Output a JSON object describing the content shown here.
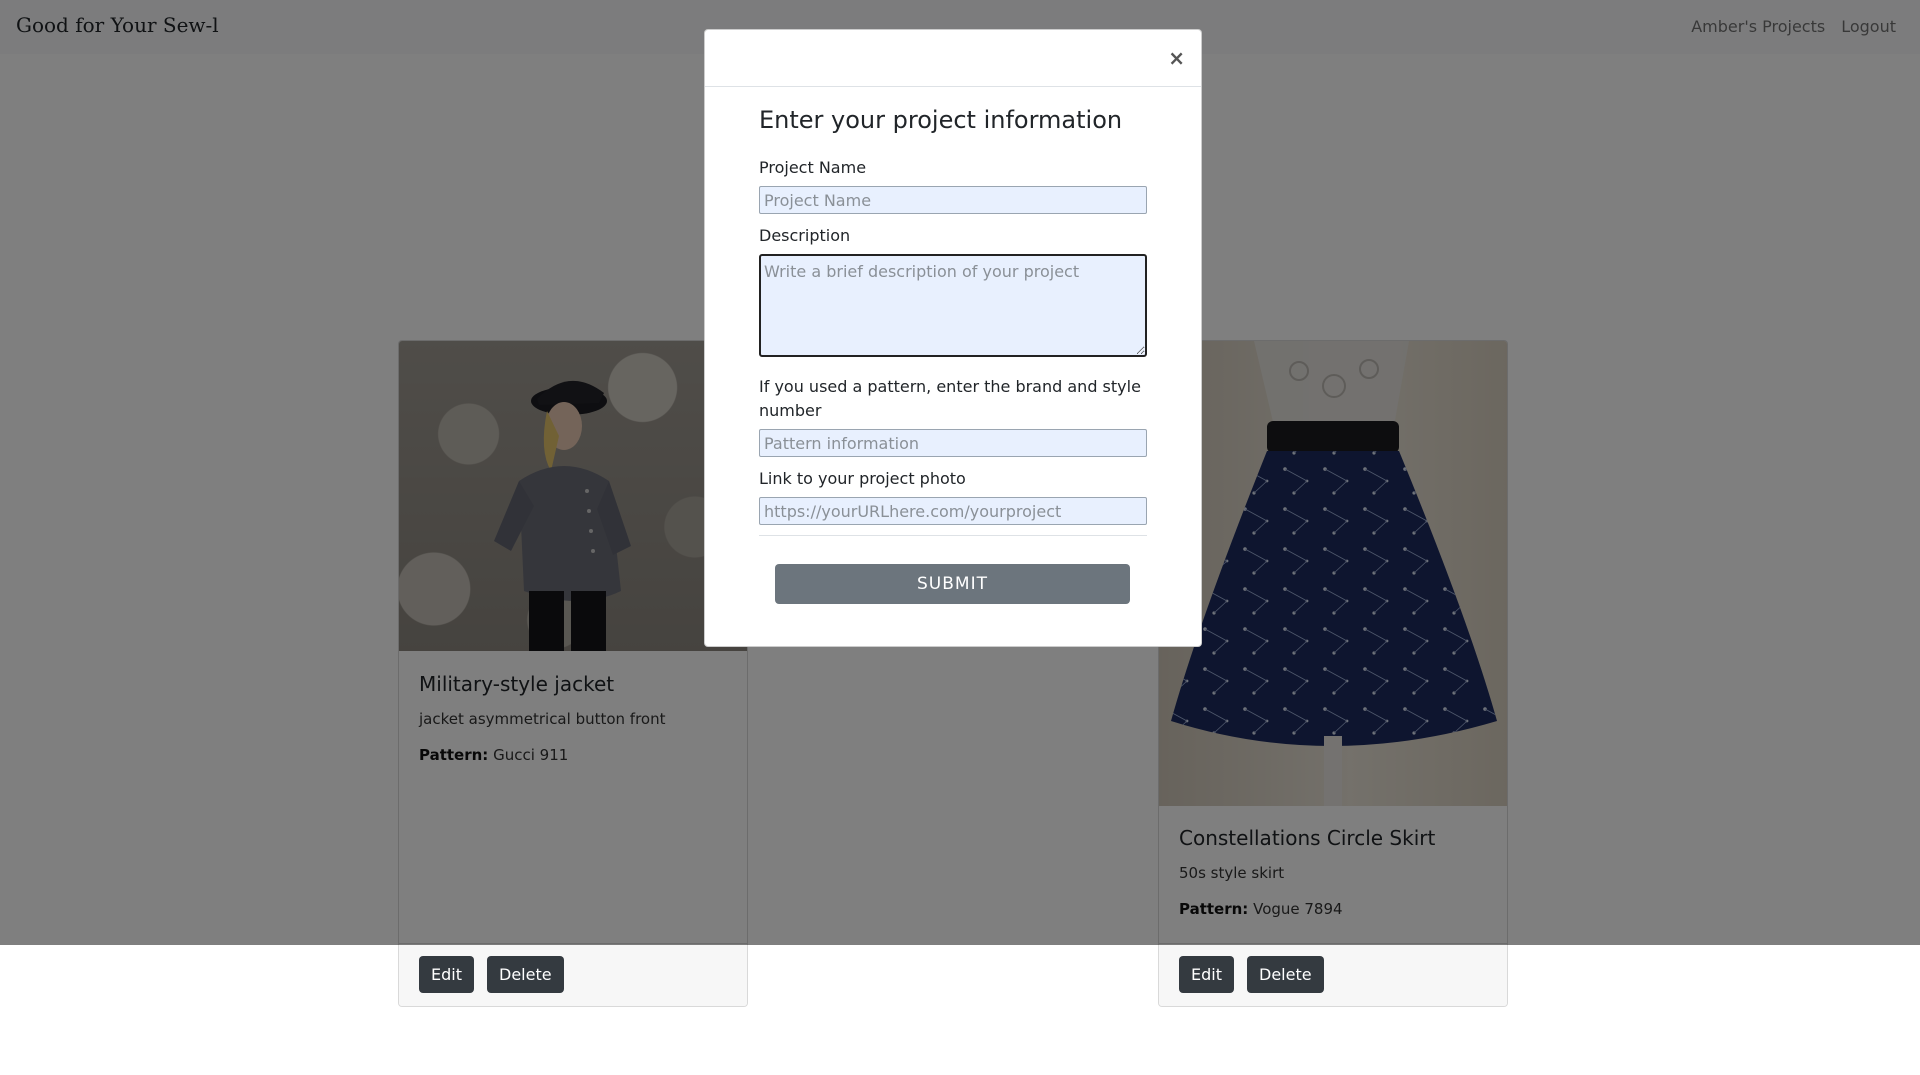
{
  "navbar": {
    "brand": "Good for Your Sew-l",
    "links": [
      "Amber's Projects",
      "Logout"
    ]
  },
  "projects": [
    {
      "title": "Military-style jacket",
      "description": "jacket asymmetrical button front",
      "pattern_label": "Pattern:",
      "pattern": "Gucci 911",
      "edit_label": "Edit",
      "delete_label": "Delete"
    },
    {
      "title": "Constellations Circle Skirt",
      "description": "50s style skirt",
      "pattern_label": "Pattern:",
      "pattern": "Vogue 7894",
      "edit_label": "Edit",
      "delete_label": "Delete"
    }
  ],
  "modal": {
    "close": "×",
    "title": "Enter your project information",
    "fields": {
      "name_label": "Project Name",
      "name_placeholder": "Project Name",
      "description_label": "Description",
      "description_placeholder": "Write a brief description of your project",
      "pattern_label": "If you used a pattern, enter the brand and style number",
      "pattern_placeholder": "Pattern information",
      "photo_label": "Link to your project photo",
      "photo_placeholder": "https://yourURLhere.com/yourproject"
    },
    "submit_label": "SUBMIT"
  }
}
